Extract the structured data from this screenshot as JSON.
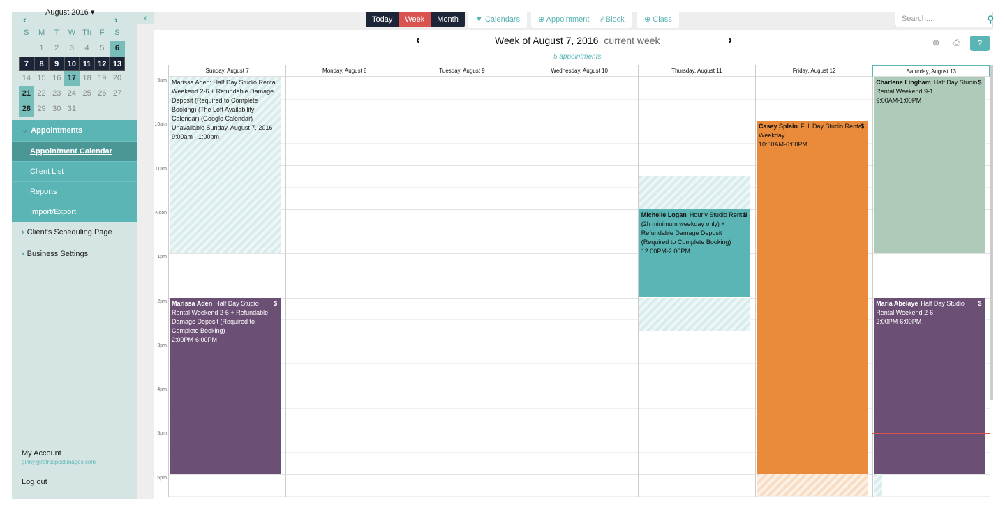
{
  "mini_calendar": {
    "month_label": "August 2016",
    "dow": [
      "S",
      "M",
      "T",
      "W",
      "Th",
      "F",
      "S"
    ],
    "cells": [
      "",
      "1",
      "2",
      "3",
      "4",
      "5",
      "6",
      "7",
      "8",
      "9",
      "10",
      "11",
      "12",
      "13",
      "14",
      "15",
      "16",
      "17",
      "18",
      "19",
      "20",
      "21",
      "22",
      "23",
      "24",
      "25",
      "26",
      "27",
      "28",
      "29",
      "30",
      "31"
    ],
    "selected_week": [
      "7",
      "8",
      "9",
      "10",
      "11",
      "12",
      "13"
    ],
    "highlighted": [
      "6",
      "17",
      "21",
      "28"
    ]
  },
  "sidebar": {
    "section": "Appointments",
    "items": [
      {
        "label": "Appointment Calendar",
        "active": true
      },
      {
        "label": "Client List"
      },
      {
        "label": "Reports"
      },
      {
        "label": "Import/Export"
      }
    ],
    "links": [
      "Client's Scheduling Page",
      "Business Settings"
    ],
    "account_label": "My Account",
    "account_email": "ginny@retrospectimages.com",
    "logout": "Log out"
  },
  "toolbar": {
    "views": [
      "Today",
      "Week",
      "Month"
    ],
    "active_view": "Week",
    "calendars": "Calendars",
    "appointment": "Appointment",
    "block": "Block",
    "class": "Class",
    "search_placeholder": "Search..."
  },
  "header": {
    "title": "Week of August 7, 2016",
    "subtitle": "current week",
    "count": "5 appointments",
    "help": "?"
  },
  "days": [
    "Sunday, August 7",
    "Monday, August 8",
    "Tuesday, August 9",
    "Wednesday, August 10",
    "Thursday, August 11",
    "Friday, August 12",
    "Saturday, August 13"
  ],
  "today_index": 6,
  "hours": [
    "9am",
    "10am",
    "11am",
    "Noon",
    "1pm",
    "2pm",
    "3pm",
    "4pm",
    "5pm",
    "6pm"
  ],
  "now_hour": 17.08,
  "colors": {
    "teal": "#5bb5b5",
    "purple": "#6b4f74",
    "orange": "#e98b3a",
    "green": "#adcbb8",
    "navy": "#1b2537",
    "red": "#d9534f"
  },
  "blocks": [
    {
      "day": 0,
      "start": 9,
      "end": 13,
      "type": "teal",
      "text": "Marissa Aden: Half Day Studio Rental Weekend 2-6 + Refundable Damage Deposit (Required to Complete Booking) (The Loft Availability Calendar) (Google Calendar) Unavailable Sunday, August 7, 2016",
      "time": "9:00am - 1:00pm"
    },
    {
      "day": 4,
      "start": 11.25,
      "end": 12,
      "type": "teal"
    },
    {
      "day": 4,
      "start": 14,
      "end": 14.75,
      "type": "teal"
    },
    {
      "day": 5,
      "start": 18,
      "end": 18.5,
      "type": "orange"
    },
    {
      "day": 6,
      "start": 18,
      "end": 18.5,
      "type": "teal"
    }
  ],
  "appointments": [
    {
      "day": 0,
      "start": 14,
      "end": 18,
      "color": "purple",
      "name": "Marissa Aden",
      "service": "Half Day Studio Rental Weekend 2-6 + Refundable Damage Deposit (Required to Complete Booking)",
      "time": "2:00PM-6:00PM",
      "flag": "$"
    },
    {
      "day": 4,
      "start": 12,
      "end": 14,
      "color": "teal",
      "name": "Michelle Logan",
      "service": "Hourly Studio Rental (2h minimum weekday only) + Refundable Damage Deposit (Required to Complete Booking)",
      "time": "12:00PM-2:00PM",
      "flag": "$"
    },
    {
      "day": 5,
      "start": 10,
      "end": 18,
      "color": "orange",
      "name": "Casey Splain",
      "service": "Full Day Studio Rental Weekday",
      "time": "10:00AM-6:00PM",
      "flag": "$"
    },
    {
      "day": 6,
      "start": 9,
      "end": 13,
      "color": "green",
      "name": "Charlene Lingham",
      "service": "Half Day Studio Rental Weekend 9-1",
      "time": "9:00AM-1:00PM",
      "flag": "$"
    },
    {
      "day": 6,
      "start": 14,
      "end": 18,
      "color": "purple",
      "name": "Maria Abelaye",
      "service": "Half Day Studio Rental Weekend 2-6",
      "time": "2:00PM-6:00PM",
      "flag": "$"
    }
  ]
}
